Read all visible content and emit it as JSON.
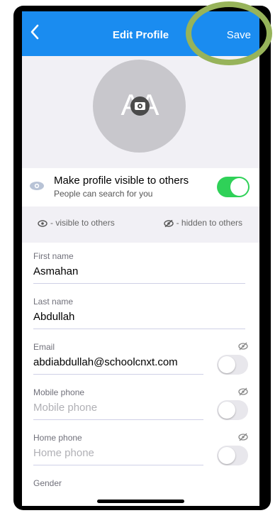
{
  "navbar": {
    "back_icon": "chevron-left-icon",
    "title": "Edit Profile",
    "save_label": "Save"
  },
  "avatar": {
    "initials": "AA",
    "camera_icon": "camera-icon"
  },
  "visibility": {
    "title": "Make profile visible to others",
    "subtitle": "People can search for you",
    "enabled": true
  },
  "legend": {
    "visible_label": "- visible to others",
    "hidden_label": "- hidden to others"
  },
  "fields": [
    {
      "label": "First name",
      "value": "Asmahan"
    },
    {
      "label": "Last name",
      "value": "Abdullah"
    },
    {
      "label": "Email",
      "value": "abdiabdullah@schoolcnxt.com",
      "visible": false
    },
    {
      "label": "Mobile phone",
      "placeholder": "Mobile phone",
      "visible": false
    },
    {
      "label": "Home phone",
      "placeholder": "Home phone",
      "visible": false
    },
    {
      "label": "Gender"
    }
  ],
  "colors": {
    "accent": "#1a8cf0",
    "toggle_on": "#2fd158",
    "highlight": "#97b35a"
  }
}
